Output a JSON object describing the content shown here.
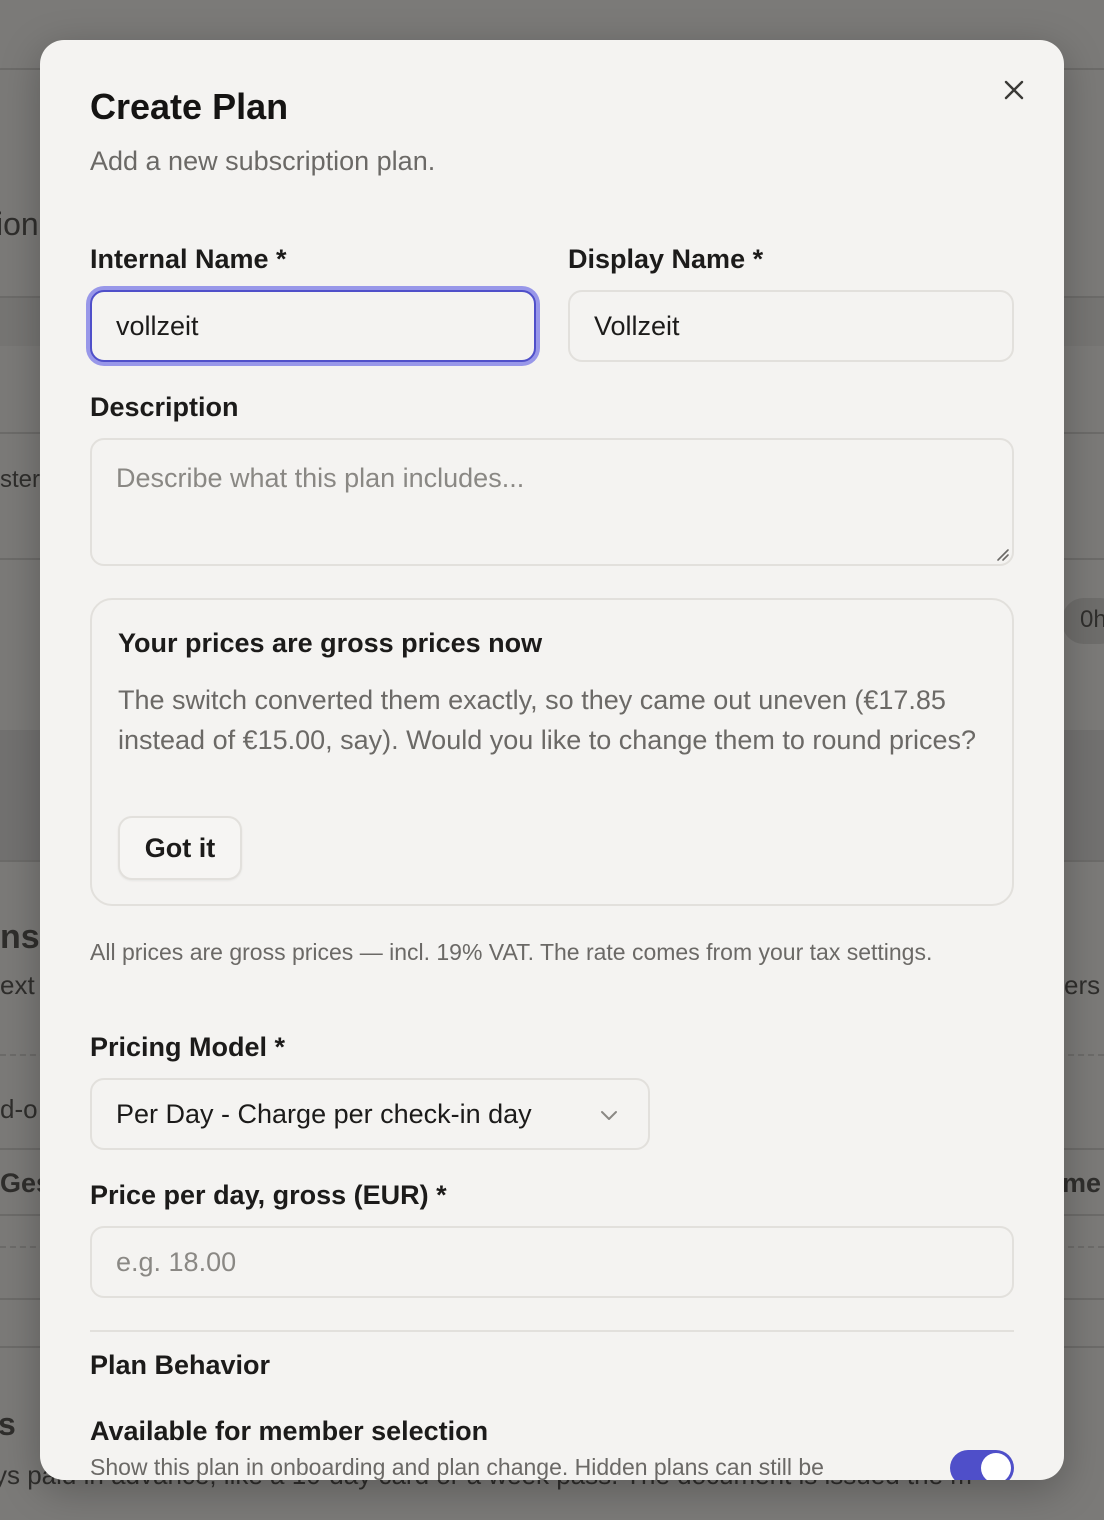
{
  "background": {
    "fragments": [
      "ion",
      "ster",
      "0h",
      "ns",
      "ext",
      "ers",
      "d-o",
      "Ges",
      "me",
      "s",
      "ys paid in advance, like a 10-day card or a week pass. The document is issued the m"
    ]
  },
  "modal": {
    "title": "Create Plan",
    "subtitle": "Add a new subscription plan.",
    "close_icon": "close-icon"
  },
  "form": {
    "internal_name": {
      "label": "Internal Name *",
      "value": "vollzeit"
    },
    "display_name": {
      "label": "Display Name *",
      "value": "Vollzeit"
    },
    "description": {
      "label": "Description",
      "value": "",
      "placeholder": "Describe what this plan includes..."
    },
    "notice": {
      "title": "Your prices are gross prices now",
      "body": "The switch converted them exactly, so they came out uneven (€17.85 instead of €15.00, say). Would you like to change them to round prices?",
      "button": "Got it"
    },
    "helper": "All prices are gross prices — incl. 19% VAT. The rate comes from your tax settings.",
    "pricing_model": {
      "label": "Pricing Model *",
      "selected": "Per Day - Charge per check-in day",
      "icon": "chevron-down-icon"
    },
    "price": {
      "label": "Price per day, gross (EUR) *",
      "value": "",
      "placeholder": "e.g. 18.00"
    }
  },
  "behavior": {
    "heading": "Plan Behavior",
    "available": {
      "label": "Available for member selection",
      "description": "Show this plan in onboarding and plan change. Hidden plans can still be",
      "enabled": true
    }
  },
  "colors": {
    "accent": "#4f4fc9",
    "focus_ring": "#7a78e6",
    "modal_bg": "#f4f3f1",
    "overlay": "#7b7a78"
  }
}
